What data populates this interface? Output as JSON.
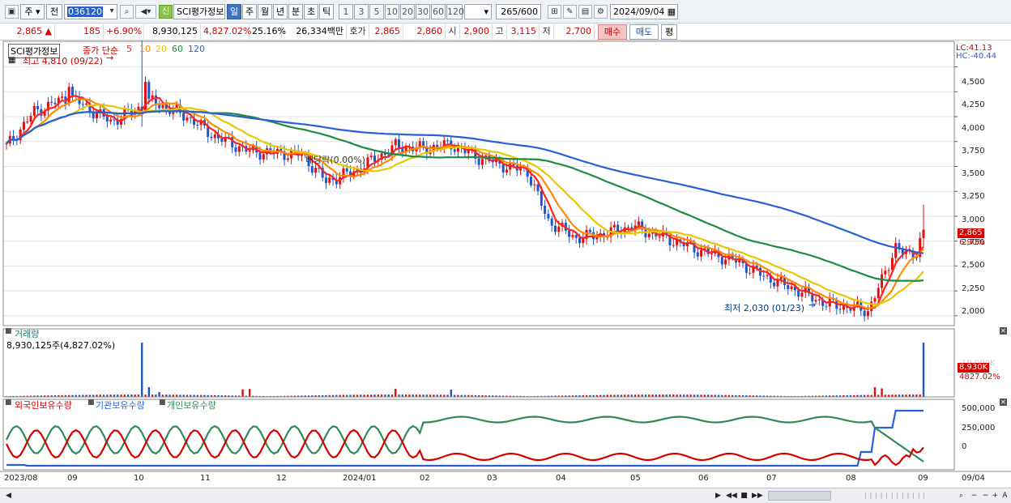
{
  "toolbar": {
    "market": "주",
    "prev_label": "전",
    "code": "036120",
    "name": "SCI평가정보",
    "new_badge": "신",
    "periods": [
      "일",
      "주",
      "월",
      "년",
      "분",
      "초",
      "틱"
    ],
    "active_period": "일",
    "intervals": [
      "1",
      "3",
      "5",
      "10",
      "20",
      "30",
      "60",
      "120"
    ],
    "count": "265",
    "count_max": "/600",
    "date": "2024/09/04"
  },
  "quote": {
    "price": "2,865",
    "arrow": "▲",
    "change": "185",
    "change_pct": "+6.90%",
    "volume": "8,930,125",
    "volume_pct": "4,827.02%",
    "turnover": "25.16%",
    "amount": "26,334백만",
    "bid_label": "호가",
    "ask": "2,865",
    "bid": "2,860",
    "open_label": "시",
    "open": "2,900",
    "high_label": "고",
    "high": "3,115",
    "low_label": "저",
    "low": "2,700",
    "buy_label": "매수",
    "sell_label": "매도",
    "avg_label": "평"
  },
  "price_panel": {
    "title": "SCI평가정보",
    "legend_prefix": "종가 단순",
    "ma": [
      {
        "period": "5",
        "color": "#ff2222"
      },
      {
        "period": "10",
        "color": "#ff8c00"
      },
      {
        "period": "20",
        "color": "#e6c800"
      },
      {
        "period": "60",
        "color": "#1e8c3c"
      },
      {
        "period": "120",
        "color": "#2a5fd6"
      }
    ],
    "high_note": "최고 4,810 (09/22)",
    "low_note": "최저 2,030 (01/23)",
    "dividend_note": "배당락(0.00%)",
    "lc": "LC:41.13",
    "hc": "HC:-40.44",
    "yticks": [
      "4,500",
      "4,250",
      "4,000",
      "3,750",
      "3,500",
      "3,250",
      "3,000",
      "2,750",
      "2,500",
      "2,250",
      "2,000"
    ],
    "last_price_tag": "2,865",
    "last_pct_tag": "6.90%"
  },
  "volume_panel": {
    "title": "거래량",
    "value": "8,930,125주(4,827.02%)",
    "tag_value": "8,930K",
    "tag_pct": "4827.02%",
    "faint_tick": "10,000K"
  },
  "holding_panel": {
    "series": [
      {
        "name": "외국인보유수량",
        "color": "#d40000"
      },
      {
        "name": "기관보유수량",
        "color": "#2a5fd6"
      },
      {
        "name": "개인보유수량",
        "color": "#2e8b57"
      }
    ],
    "yticks": [
      "500,000",
      "250,000",
      "0"
    ]
  },
  "xaxis": {
    "labels": [
      "2023/08",
      "09",
      "10",
      "11",
      "12",
      "2024/01",
      "02",
      "03",
      "04",
      "05",
      "06",
      "07",
      "08",
      "09"
    ],
    "end_label": "09/04"
  },
  "chart_data": {
    "type": "candlestick",
    "title": "SCI평가정보",
    "ylim": [
      1950,
      4700
    ],
    "x_range": [
      "2023/08",
      "2024/09/04"
    ],
    "candles_approx": [
      {
        "month": "2023/08",
        "close": 3800
      },
      {
        "month": "2023/09",
        "close": 4150
      },
      {
        "month": "2023/10",
        "close": 4050
      },
      {
        "month": "2023/11",
        "close": 3650
      },
      {
        "month": "2023/12",
        "close": 3400
      },
      {
        "month": "2024/01",
        "close": 3700
      },
      {
        "month": "2024/02",
        "close": 3650
      },
      {
        "month": "2024/03",
        "close": 2800
      },
      {
        "month": "2024/04",
        "close": 2800
      },
      {
        "month": "2024/05",
        "close": 2550
      },
      {
        "month": "2024/06",
        "close": 2300
      },
      {
        "month": "2024/07",
        "close": 2070
      },
      {
        "month": "2024/08",
        "close": 2550
      },
      {
        "month": "2024/09",
        "close": 2865
      }
    ],
    "last": {
      "open": 2900,
      "high": 3115,
      "low": 2700,
      "close": 2865
    },
    "extremes": {
      "high": 4810,
      "high_date": "09/22",
      "low": 2030,
      "low_date": "01/23"
    }
  }
}
